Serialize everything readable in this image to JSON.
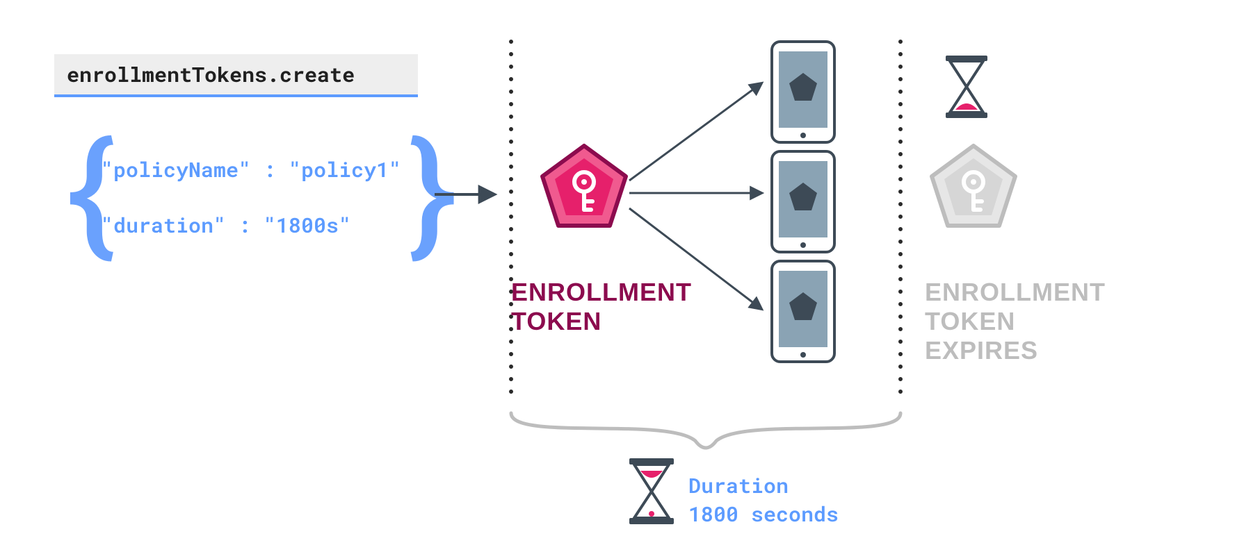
{
  "api": {
    "method": "enrollmentTokens.create"
  },
  "request": {
    "policyNameKey": "\"policyName\"",
    "policyNameSep": " : ",
    "policyNameVal": "\"policy1\"",
    "durationKey": "\"duration\"",
    "durationSep": " : ",
    "durationVal": "\"1800s\""
  },
  "labels": {
    "enrollment_line1": "ENROLLMENT",
    "enrollment_line2": "TOKEN",
    "expire_line1": "ENROLLMENT",
    "expire_line2": "TOKEN",
    "expire_line3": "EXPIRES",
    "duration_line1": "Duration",
    "duration_line2": "1800 seconds"
  },
  "colors": {
    "blue": "#5c9bff",
    "maroon": "#8c0b4e",
    "pink": "#e6206b",
    "pinkFill": "#f05a8f",
    "grey": "#bdbdbd",
    "slate": "#8aa3b4",
    "dark": "#3d4a56"
  }
}
